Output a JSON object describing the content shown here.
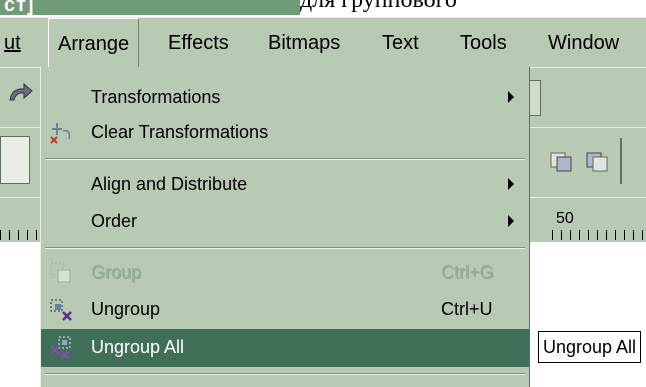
{
  "window": {
    "title_fragment": "ст]",
    "background_text": "для группового"
  },
  "menubar": {
    "items": [
      {
        "label": "ut"
      },
      {
        "label": "Arrange"
      },
      {
        "label": "Effects"
      },
      {
        "label": "Bitmaps"
      },
      {
        "label": "Text"
      },
      {
        "label": "Tools"
      },
      {
        "label": "Window"
      }
    ]
  },
  "ruler": {
    "visible_number": "50"
  },
  "menu": {
    "items": [
      {
        "label": "Transformations",
        "submenu": true,
        "enabled": true
      },
      {
        "label": "Clear Transformations",
        "icon": "clear-transformations-icon",
        "enabled": true
      },
      {
        "label": "Align and Distribute",
        "submenu": true,
        "enabled": true
      },
      {
        "label": "Order",
        "submenu": true,
        "enabled": true
      },
      {
        "label": "Group",
        "shortcut": "Ctrl+G",
        "icon": "group-icon",
        "enabled": false
      },
      {
        "label": "Ungroup",
        "shortcut": "Ctrl+U",
        "icon": "ungroup-icon",
        "enabled": true
      },
      {
        "label": "Ungroup All",
        "icon": "ungroup-all-icon",
        "enabled": true,
        "selected": true
      }
    ]
  },
  "tooltip": {
    "text": "Ungroup All"
  },
  "colors": {
    "menu_bg": "#b8cab4",
    "highlight": "#3f6f57",
    "title_bar": "#6f9b78"
  }
}
